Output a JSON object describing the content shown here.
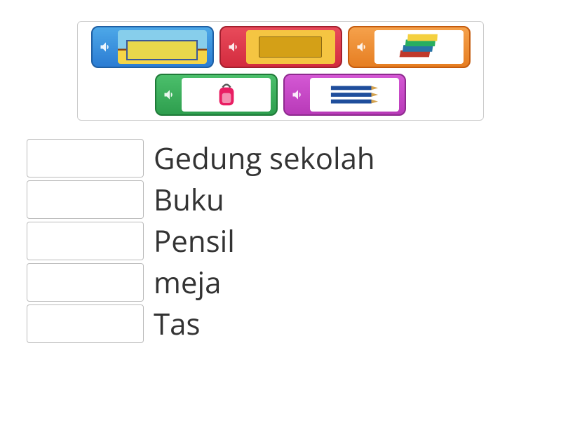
{
  "cards": [
    {
      "color": "blue",
      "image": "school-building",
      "name": "card-school"
    },
    {
      "color": "red",
      "image": "desk",
      "name": "card-desk"
    },
    {
      "color": "orange",
      "image": "books",
      "name": "card-books"
    },
    {
      "color": "green",
      "image": "backpack",
      "name": "card-backpack"
    },
    {
      "color": "magenta",
      "image": "pencils",
      "name": "card-pencils"
    }
  ],
  "answers": [
    {
      "label": "Gedung sekolah",
      "name": "answer-gedung-sekolah"
    },
    {
      "label": "Buku",
      "name": "answer-buku"
    },
    {
      "label": "Pensil",
      "name": "answer-pensil"
    },
    {
      "label": "meja",
      "name": "answer-meja"
    },
    {
      "label": "Tas",
      "name": "answer-tas"
    }
  ]
}
